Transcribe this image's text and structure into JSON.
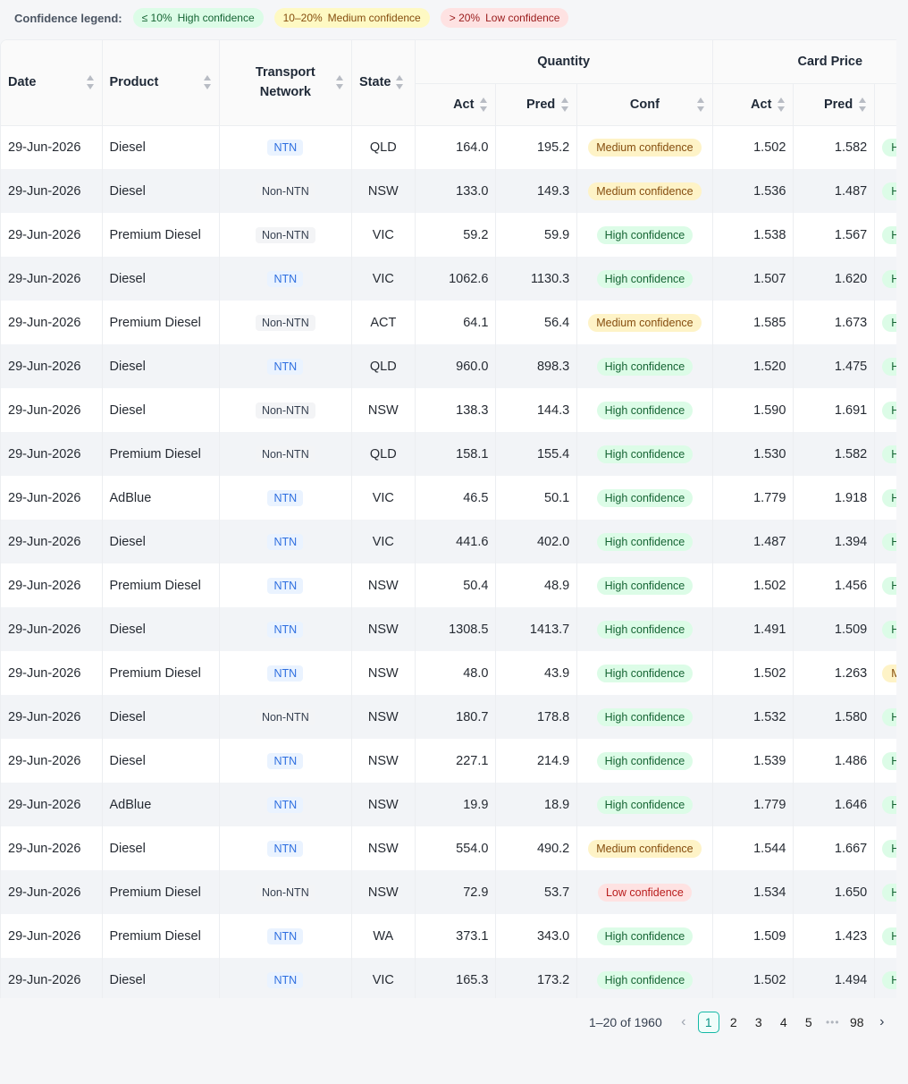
{
  "legend": {
    "title": "Confidence legend:",
    "high": {
      "threshold": "≤ 10%",
      "label": "High confidence"
    },
    "medium": {
      "threshold": "10–20%",
      "label": "Medium confidence"
    },
    "low": {
      "threshold": "> 20%",
      "label": "Low confidence"
    }
  },
  "columns": {
    "date": "Date",
    "product": "Product",
    "network_line1": "Transport",
    "network_line2": "Network",
    "state": "State",
    "quantity": "Quantity",
    "card_price": "Card Price",
    "act": "Act",
    "pred": "Pred",
    "conf": "Conf"
  },
  "rows": [
    {
      "date": "29-Jun-2026",
      "product": "Diesel",
      "network": "NTN",
      "state": "QLD",
      "q_act": "164.0",
      "q_pred": "195.2",
      "q_conf": "Medium confidence",
      "p_act": "1.502",
      "p_pred": "1.582",
      "p_conf": "H"
    },
    {
      "date": "29-Jun-2026",
      "product": "Diesel",
      "network": "Non-NTN",
      "state": "NSW",
      "q_act": "133.0",
      "q_pred": "149.3",
      "q_conf": "Medium confidence",
      "p_act": "1.536",
      "p_pred": "1.487",
      "p_conf": "H"
    },
    {
      "date": "29-Jun-2026",
      "product": "Premium Diesel",
      "network": "Non-NTN",
      "state": "VIC",
      "q_act": "59.2",
      "q_pred": "59.9",
      "q_conf": "High confidence",
      "p_act": "1.538",
      "p_pred": "1.567",
      "p_conf": "H"
    },
    {
      "date": "29-Jun-2026",
      "product": "Diesel",
      "network": "NTN",
      "state": "VIC",
      "q_act": "1062.6",
      "q_pred": "1130.3",
      "q_conf": "High confidence",
      "p_act": "1.507",
      "p_pred": "1.620",
      "p_conf": "H"
    },
    {
      "date": "29-Jun-2026",
      "product": "Premium Diesel",
      "network": "Non-NTN",
      "state": "ACT",
      "q_act": "64.1",
      "q_pred": "56.4",
      "q_conf": "Medium confidence",
      "p_act": "1.585",
      "p_pred": "1.673",
      "p_conf": "H"
    },
    {
      "date": "29-Jun-2026",
      "product": "Diesel",
      "network": "NTN",
      "state": "QLD",
      "q_act": "960.0",
      "q_pred": "898.3",
      "q_conf": "High confidence",
      "p_act": "1.520",
      "p_pred": "1.475",
      "p_conf": "H"
    },
    {
      "date": "29-Jun-2026",
      "product": "Diesel",
      "network": "Non-NTN",
      "state": "NSW",
      "q_act": "138.3",
      "q_pred": "144.3",
      "q_conf": "High confidence",
      "p_act": "1.590",
      "p_pred": "1.691",
      "p_conf": "H"
    },
    {
      "date": "29-Jun-2026",
      "product": "Premium Diesel",
      "network": "Non-NTN",
      "state": "QLD",
      "q_act": "158.1",
      "q_pred": "155.4",
      "q_conf": "High confidence",
      "p_act": "1.530",
      "p_pred": "1.582",
      "p_conf": "H"
    },
    {
      "date": "29-Jun-2026",
      "product": "AdBlue",
      "network": "NTN",
      "state": "VIC",
      "q_act": "46.5",
      "q_pred": "50.1",
      "q_conf": "High confidence",
      "p_act": "1.779",
      "p_pred": "1.918",
      "p_conf": "H"
    },
    {
      "date": "29-Jun-2026",
      "product": "Diesel",
      "network": "NTN",
      "state": "VIC",
      "q_act": "441.6",
      "q_pred": "402.0",
      "q_conf": "High confidence",
      "p_act": "1.487",
      "p_pred": "1.394",
      "p_conf": "H"
    },
    {
      "date": "29-Jun-2026",
      "product": "Premium Diesel",
      "network": "NTN",
      "state": "NSW",
      "q_act": "50.4",
      "q_pred": "48.9",
      "q_conf": "High confidence",
      "p_act": "1.502",
      "p_pred": "1.456",
      "p_conf": "H"
    },
    {
      "date": "29-Jun-2026",
      "product": "Diesel",
      "network": "NTN",
      "state": "NSW",
      "q_act": "1308.5",
      "q_pred": "1413.7",
      "q_conf": "High confidence",
      "p_act": "1.491",
      "p_pred": "1.509",
      "p_conf": "H"
    },
    {
      "date": "29-Jun-2026",
      "product": "Premium Diesel",
      "network": "NTN",
      "state": "NSW",
      "q_act": "48.0",
      "q_pred": "43.9",
      "q_conf": "High confidence",
      "p_act": "1.502",
      "p_pred": "1.263",
      "p_conf": "Me"
    },
    {
      "date": "29-Jun-2026",
      "product": "Diesel",
      "network": "Non-NTN",
      "state": "NSW",
      "q_act": "180.7",
      "q_pred": "178.8",
      "q_conf": "High confidence",
      "p_act": "1.532",
      "p_pred": "1.580",
      "p_conf": "H"
    },
    {
      "date": "29-Jun-2026",
      "product": "Diesel",
      "network": "NTN",
      "state": "NSW",
      "q_act": "227.1",
      "q_pred": "214.9",
      "q_conf": "High confidence",
      "p_act": "1.539",
      "p_pred": "1.486",
      "p_conf": "H"
    },
    {
      "date": "29-Jun-2026",
      "product": "AdBlue",
      "network": "NTN",
      "state": "NSW",
      "q_act": "19.9",
      "q_pred": "18.9",
      "q_conf": "High confidence",
      "p_act": "1.779",
      "p_pred": "1.646",
      "p_conf": "H"
    },
    {
      "date": "29-Jun-2026",
      "product": "Diesel",
      "network": "NTN",
      "state": "NSW",
      "q_act": "554.0",
      "q_pred": "490.2",
      "q_conf": "Medium confidence",
      "p_act": "1.544",
      "p_pred": "1.667",
      "p_conf": "H"
    },
    {
      "date": "29-Jun-2026",
      "product": "Premium Diesel",
      "network": "Non-NTN",
      "state": "NSW",
      "q_act": "72.9",
      "q_pred": "53.7",
      "q_conf": "Low confidence",
      "p_act": "1.534",
      "p_pred": "1.650",
      "p_conf": "H"
    },
    {
      "date": "29-Jun-2026",
      "product": "Premium Diesel",
      "network": "NTN",
      "state": "WA",
      "q_act": "373.1",
      "q_pred": "343.0",
      "q_conf": "High confidence",
      "p_act": "1.509",
      "p_pred": "1.423",
      "p_conf": "H"
    },
    {
      "date": "29-Jun-2026",
      "product": "Diesel",
      "network": "NTN",
      "state": "VIC",
      "q_act": "165.3",
      "q_pred": "173.2",
      "q_conf": "High confidence",
      "p_act": "1.502",
      "p_pred": "1.494",
      "p_conf": "H"
    }
  ],
  "pagination": {
    "summary": "1–20 of 1960",
    "pages": [
      "1",
      "2",
      "3",
      "4",
      "5"
    ],
    "current": "1",
    "ellipsis": "•••",
    "last": "98",
    "prev_icon": "chevron-left-icon",
    "next_icon": "chevron-right-icon"
  },
  "colors": {
    "high_bg": "#dcfce7",
    "high_fg": "#166534",
    "medium_bg": "#fef3c7",
    "medium_fg": "#854d0e",
    "low_bg": "#fee2e2",
    "low_fg": "#b91c1c",
    "ntn_bg": "#eaf3ff",
    "ntn_fg": "#2f6fe0",
    "accent": "#14b8a6"
  }
}
